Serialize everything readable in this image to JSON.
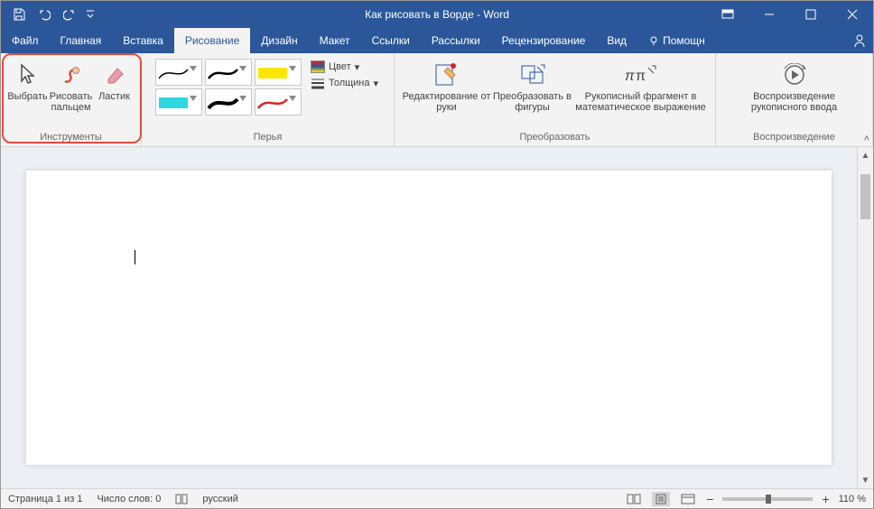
{
  "title": "Как рисовать в Ворде  -  Word",
  "tabs": {
    "file": "Файл",
    "home": "Главная",
    "insert": "Вставка",
    "draw": "Рисование",
    "design": "Дизайн",
    "layout": "Макет",
    "references": "Ссылки",
    "mailings": "Рассылки",
    "review": "Рецензирование",
    "view": "Вид",
    "help": "Помощн"
  },
  "ribbon": {
    "tools": {
      "label": "Инструменты",
      "select": "Выбрать",
      "touch": "Рисовать пальцем",
      "eraser": "Ластик"
    },
    "pens": {
      "label": "Перья",
      "color_label": "Цвет",
      "thickness_label": "Толщина"
    },
    "convert": {
      "label": "Преобразовать",
      "ink_editor": "Редактирование от руки",
      "to_shapes": "Преобразовать в фигуры",
      "to_math": "Рукописный фрагмент в математическое выражение"
    },
    "replay": {
      "label": "Воспроизведение",
      "ink_replay": "Воспроизведение рукописного ввода"
    }
  },
  "status": {
    "page": "Страница 1 из 1",
    "words": "Число слов: 0",
    "lang": "русский",
    "zoom": "110 %"
  }
}
